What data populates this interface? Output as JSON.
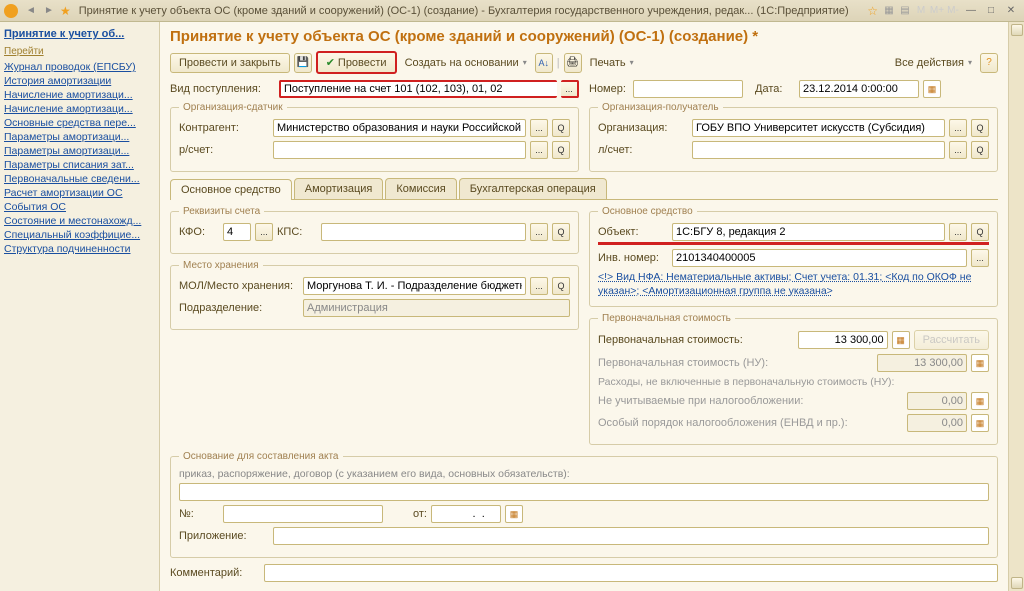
{
  "window": {
    "title": "Принятие к учету объекта ОС (кроме зданий и сооружений) (ОС-1) (создание) - Бухгалтерия государственного учреждения, редак... (1С:Предприятие)"
  },
  "sidebar": {
    "head": "Принятие к учету об...",
    "section": "Перейти",
    "items": [
      "Журнал проводок (ЕПСБУ)",
      "История амортизации",
      "Начисление амортизаци...",
      "Начисление амортизаци...",
      "Основные средства пере...",
      "Параметры амортизаци...",
      "Параметры амортизаци...",
      "Параметры списания зат...",
      "Первоначальные сведени...",
      "Расчет амортизации ОС",
      "События ОС",
      "Состояние и местонахожд...",
      "Специальный коэффицие...",
      "Структура подчиненности"
    ]
  },
  "page_title": "Принятие к учету объекта ОС (кроме зданий и сооружений) (ОС-1) (создание) *",
  "toolbar": {
    "post_close": "Провести и закрыть",
    "post": "Провести",
    "create_based": "Создать на основании",
    "print": "Печать",
    "all_actions": "Все действия"
  },
  "top_row": {
    "receipt_type_lbl": "Вид поступления:",
    "receipt_type": "Поступление на счет 101 (102, 103), 01, 02",
    "number_lbl": "Номер:",
    "date_lbl": "Дата:",
    "date": "23.12.2014 0:00:00"
  },
  "sender": {
    "legend": "Организация-сдатчик",
    "contragent_lbl": "Контрагент:",
    "contragent": "Министерство образования и науки Российской Федерации",
    "account_lbl": "р/счет:"
  },
  "receiver": {
    "legend": "Организация-получатель",
    "org_lbl": "Организация:",
    "org": "ГОБУ ВПО Университет искусств (Субсидия)",
    "account_lbl": "л/счет:"
  },
  "tabs": [
    "Основное средство",
    "Амортизация",
    "Комиссия",
    "Бухгалтерская операция"
  ],
  "requisites": {
    "legend": "Реквизиты счета",
    "kfo_lbl": "КФО:",
    "kfo": "4",
    "kps_lbl": "КПС:"
  },
  "storage": {
    "legend": "Место хранения",
    "mol_lbl": "МОЛ/Место хранения:",
    "mol": "Моргунова Т. И. - Подразделение бюджетного учреждени",
    "dept_lbl": "Подразделение:",
    "dept": "Администрация"
  },
  "asset": {
    "legend": "Основное средство",
    "object_lbl": "Объект:",
    "object": "1С:БГУ 8, редакция 2",
    "inv_lbl": "Инв. номер:",
    "inv": "2101340400005",
    "link": "<!> Вид НФА: Нематериальные активы; Счет учета: 01.31; <Код по ОКОФ не указан>; <Амортизационная группа не указана>"
  },
  "cost": {
    "legend": "Первоначальная стоимость",
    "cost_lbl": "Первоначальная стоимость:",
    "cost_val": "13 300,00",
    "calc_btn": "Рассчитать",
    "cost_nu_lbl": "Первоначальная стоимость (НУ):",
    "cost_nu_val": "13 300,00",
    "exp_lbl": "Расходы, не включенные в первоначальную стоимость (НУ):",
    "not_tax_lbl": "Не учитываемые при налогообложении:",
    "zero1": "0,00",
    "special_lbl": "Особый порядок налогообложения (ЕНВД и пр.):",
    "zero2": "0,00"
  },
  "act": {
    "legend": "Основание для составления акта",
    "desc": "приказ, распоряжение, договор (с указанием его вида, основных обязательств):",
    "num_lbl": "№:",
    "from_lbl": "от:",
    "attach_lbl": "Приложение:"
  },
  "comment_lbl": "Комментарий:"
}
